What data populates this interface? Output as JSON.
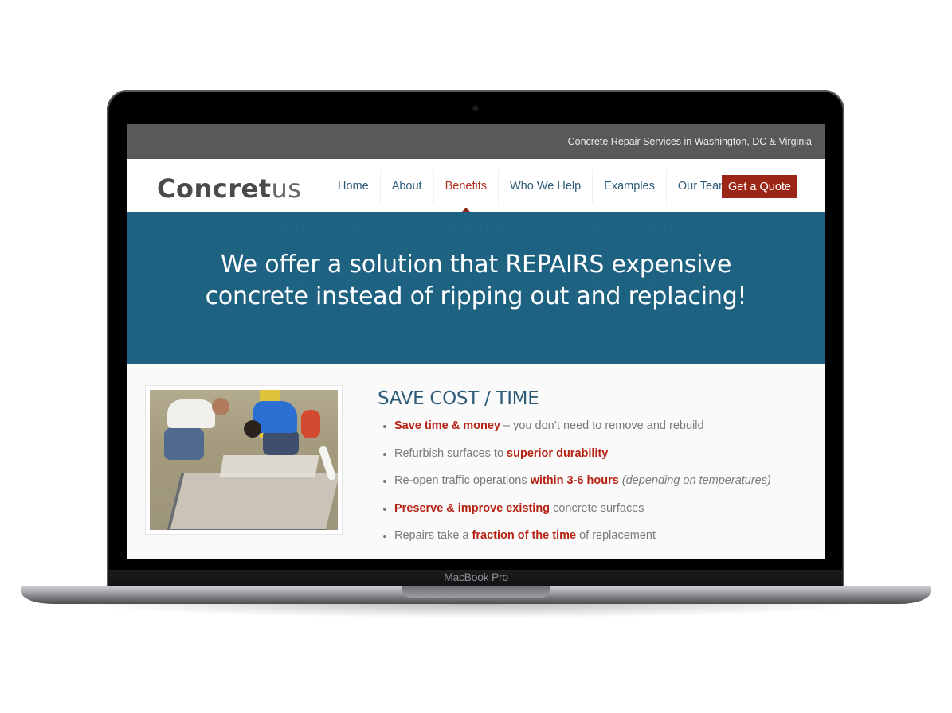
{
  "device": {
    "label": "MacBook Pro"
  },
  "site": {
    "topbar_tagline": "Concrete Repair Services in Washington, DC & Virginia",
    "logo": {
      "bold": "Concret",
      "light": "us"
    },
    "nav": [
      {
        "label": "Home",
        "active": false
      },
      {
        "label": "About",
        "active": false
      },
      {
        "label": "Benefits",
        "active": true
      },
      {
        "label": "Who We Help",
        "active": false
      },
      {
        "label": "Examples",
        "active": false
      },
      {
        "label": "Our Team",
        "active": false
      }
    ],
    "cta_label": "Get a Quote",
    "hero_text": "We offer a solution that REPAIRS expensive concrete instead of ripping out and replacing!",
    "section": {
      "title": "SAVE COST / TIME",
      "photo_alt": "Two workers applying repair material to a concrete floor",
      "bullets": [
        [
          {
            "t": "Save time & money",
            "hl": true
          },
          {
            "t": " – you don’t need to remove and rebuild",
            "hl": false
          }
        ],
        [
          {
            "t": "Refurbish surfaces to ",
            "hl": false
          },
          {
            "t": "superior durability",
            "hl": true
          }
        ],
        [
          {
            "t": "Re-open traffic operations ",
            "hl": false
          },
          {
            "t": "within 3-6 hours",
            "hl": true
          },
          {
            "t": " ",
            "hl": false
          },
          {
            "t": "(depending on temperatures)",
            "note": true
          }
        ],
        [
          {
            "t": "Preserve & improve existing",
            "hl": true
          },
          {
            "t": " concrete surfaces",
            "hl": false
          }
        ],
        [
          {
            "t": "Repairs take a ",
            "hl": false
          },
          {
            "t": "fraction of the time",
            "hl": true
          },
          {
            "t": " of replacement",
            "hl": false
          }
        ]
      ]
    }
  },
  "colors": {
    "topbar": "#595959",
    "nav_text": "#2d5c79",
    "active_nav": "#b1311f",
    "cta_bg": "#9b2616",
    "hero_bg": "#1e6282",
    "highlight": "#b52214",
    "body_text": "#7a7a7a"
  }
}
